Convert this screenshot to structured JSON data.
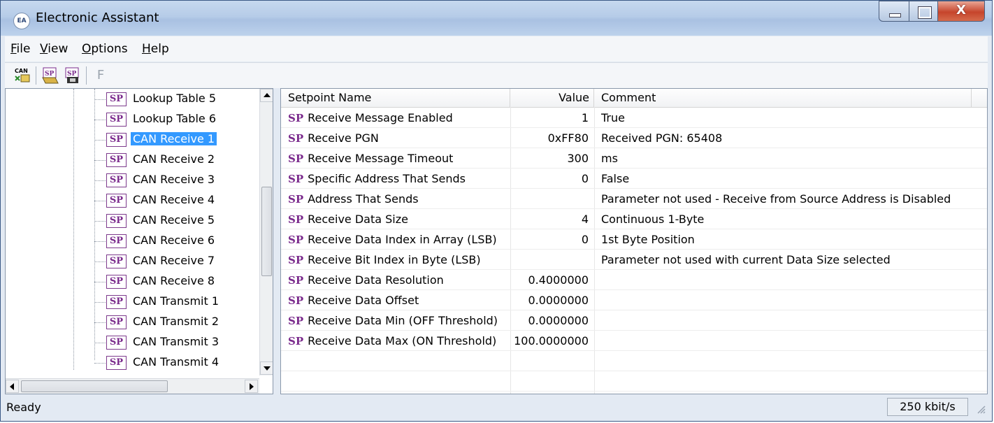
{
  "window": {
    "title": "Electronic Assistant",
    "icon": "app-logo-icon"
  },
  "menu": [
    "File",
    "View",
    "Options",
    "Help"
  ],
  "toolbar": {
    "buttons": [
      {
        "name": "can-connect-icon",
        "label": "CAN"
      },
      {
        "name": "open-setpoints-icon",
        "label": "SP"
      },
      {
        "name": "save-setpoints-icon",
        "label": "SP"
      },
      {
        "name": "flash-icon",
        "label": "F"
      }
    ]
  },
  "tree": {
    "items": [
      {
        "label": "Lookup Table 5",
        "selected": false
      },
      {
        "label": "Lookup Table 6",
        "selected": false
      },
      {
        "label": "CAN Receive 1",
        "selected": true
      },
      {
        "label": "CAN Receive 2",
        "selected": false
      },
      {
        "label": "CAN Receive 3",
        "selected": false
      },
      {
        "label": "CAN Receive 4",
        "selected": false
      },
      {
        "label": "CAN Receive 5",
        "selected": false
      },
      {
        "label": "CAN Receive 6",
        "selected": false
      },
      {
        "label": "CAN Receive 7",
        "selected": false
      },
      {
        "label": "CAN Receive 8",
        "selected": false
      },
      {
        "label": "CAN Transmit 1",
        "selected": false
      },
      {
        "label": "CAN Transmit 2",
        "selected": false
      },
      {
        "label": "CAN Transmit 3",
        "selected": false
      },
      {
        "label": "CAN Transmit 4",
        "selected": false
      }
    ],
    "icon_text": "SP"
  },
  "grid": {
    "columns": [
      "Setpoint Name",
      "Value",
      "Comment"
    ],
    "prefix": "SP",
    "rows": [
      {
        "name": "Receive Message Enabled",
        "value": "1",
        "comment": "True"
      },
      {
        "name": "Receive PGN",
        "value": "0xFF80",
        "comment": "Received PGN: 65408"
      },
      {
        "name": "Receive Message Timeout",
        "value": "300",
        "comment": "ms"
      },
      {
        "name": "Specific Address That Sends",
        "value": "0",
        "comment": "False"
      },
      {
        "name": "Address That Sends",
        "value": "",
        "comment": "Parameter not used - Receive from Source Address is Disabled"
      },
      {
        "name": "Receive Data Size",
        "value": "4",
        "comment": "Continuous 1-Byte"
      },
      {
        "name": "Receive Data Index in Array (LSB)",
        "value": "0",
        "comment": "1st Byte Position"
      },
      {
        "name": "Receive Bit Index in Byte (LSB)",
        "value": "",
        "comment": "Parameter not used with current Data Size selected"
      },
      {
        "name": "Receive Data Resolution",
        "value": "0.4000000",
        "comment": ""
      },
      {
        "name": "Receive Data Offset",
        "value": "0.0000000",
        "comment": ""
      },
      {
        "name": "Receive Data Min (OFF Threshold)",
        "value": "0.0000000",
        "comment": ""
      },
      {
        "name": "Receive Data Max (ON Threshold)",
        "value": "100.0000000",
        "comment": ""
      }
    ]
  },
  "status": {
    "text": "Ready",
    "baud": "250 kbit/s"
  },
  "colors": {
    "selection": "#3399ff",
    "sp_purple": "#7a2a8c"
  }
}
